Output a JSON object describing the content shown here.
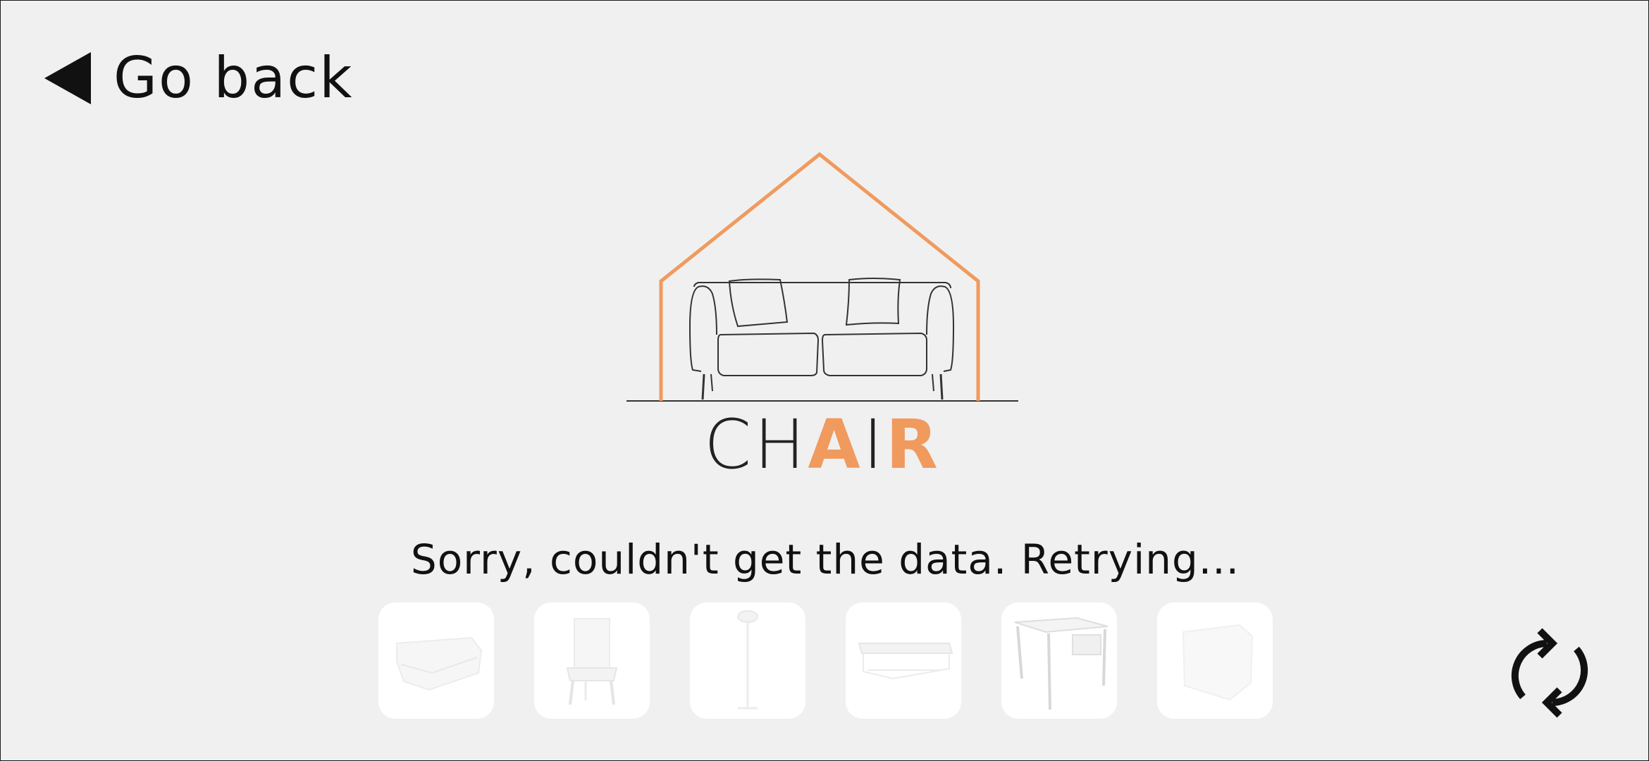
{
  "header": {
    "back_label": "Go back",
    "back_icon": "triangle-left-icon"
  },
  "logo": {
    "word_plain_1": "CH",
    "word_accent": "AI",
    "word_plain_2": "",
    "word_accent_2": "R",
    "accent_color": "#f09a5e",
    "icon": "house-sofa-logo"
  },
  "status": {
    "message": "Sorry, couldn't get the data. Retrying..."
  },
  "categories": [
    {
      "icon": "sofa-icon"
    },
    {
      "icon": "chair-icon"
    },
    {
      "icon": "floor-lamp-icon"
    },
    {
      "icon": "coffee-table-icon"
    },
    {
      "icon": "desk-icon"
    },
    {
      "icon": "cabinet-icon"
    }
  ],
  "refresh": {
    "icon": "refresh-icon"
  },
  "colors": {
    "background": "#f0f0f0",
    "accent": "#f09a5e",
    "text": "#111111",
    "tile": "#ffffff"
  }
}
